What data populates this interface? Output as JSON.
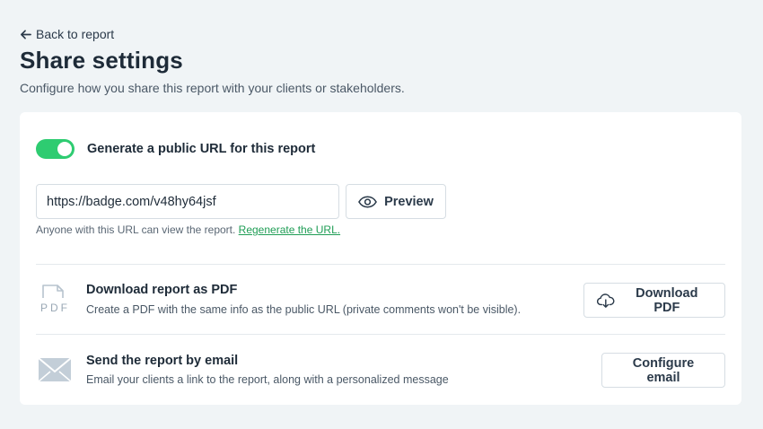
{
  "header": {
    "back_label": "Back to report",
    "title": "Share settings",
    "subtitle": "Configure how you share this report with your clients or stakeholders."
  },
  "public_url": {
    "toggle_on": true,
    "toggle_label": "Generate a public URL for this report",
    "url_value": "https://badge.com/v48hy64jsf",
    "preview_label": "Preview",
    "hint_text": "Anyone with this URL can view the report.",
    "regenerate_label": "Regenerate the URL."
  },
  "pdf": {
    "icon_text": "PDF",
    "title": "Download report as PDF",
    "description": "Create a PDF with the same info as the public URL (private comments won't be visible).",
    "button_label": "Download PDF"
  },
  "email": {
    "title": "Send the report by email",
    "description": "Email your clients a link to the report, along with a personalized message",
    "button_label": "Configure email"
  },
  "colors": {
    "toggle": "#2ecc71",
    "link": "#1f9d55",
    "background": "#f0f4f6"
  }
}
